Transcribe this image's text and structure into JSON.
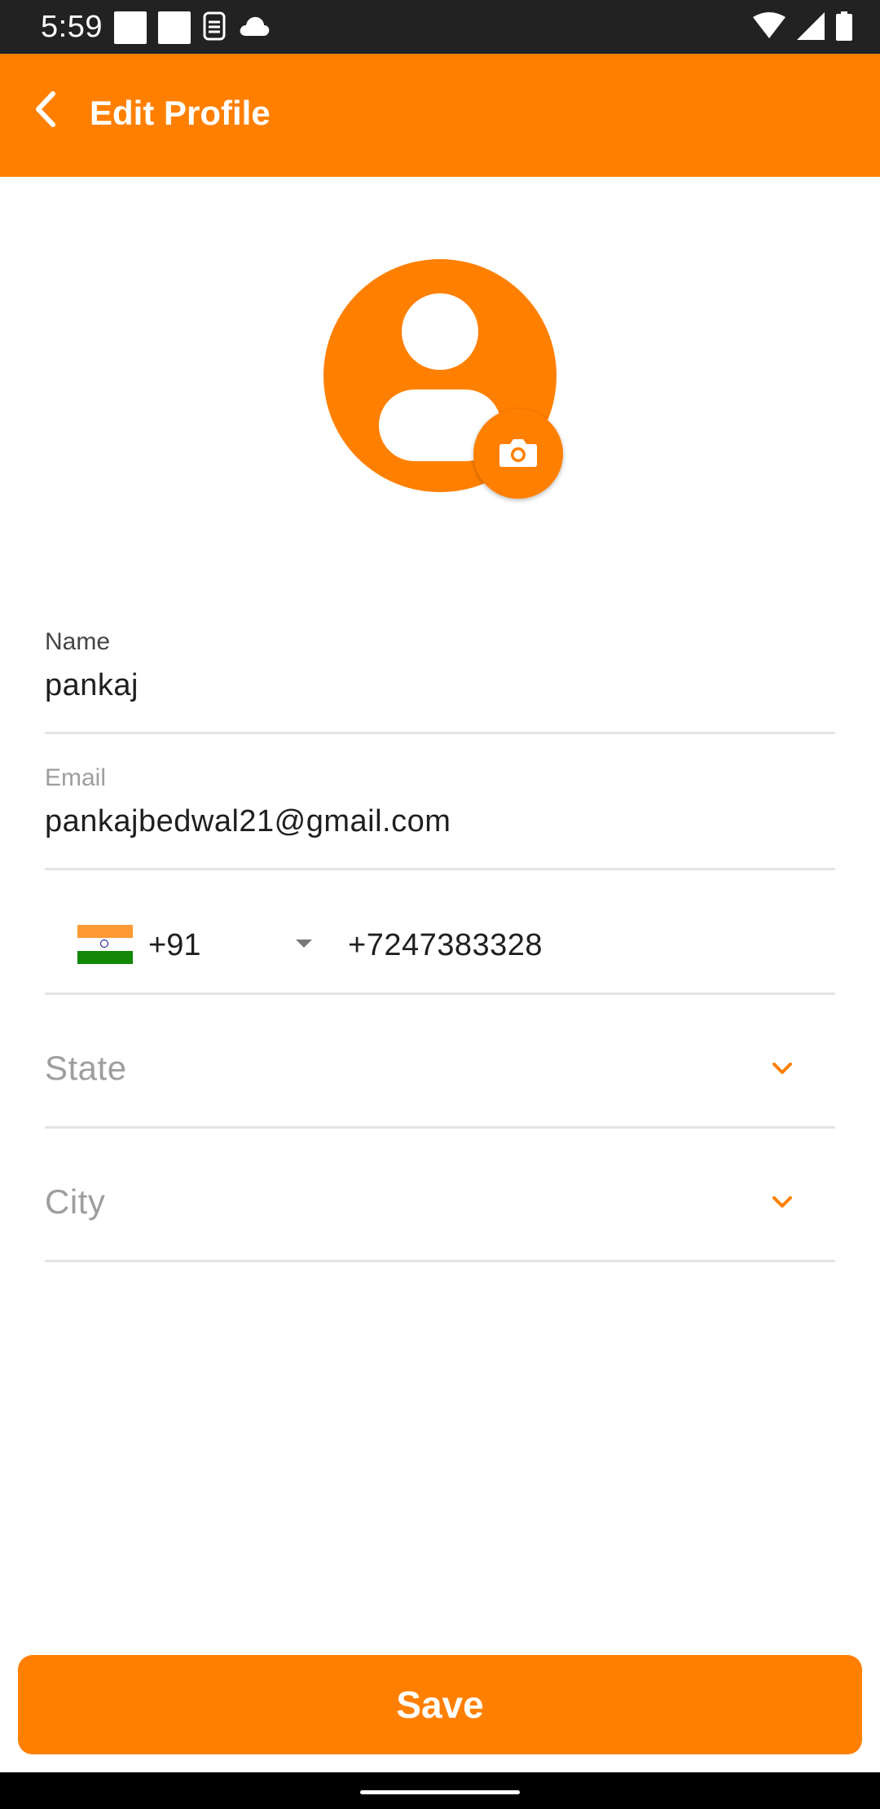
{
  "status_bar": {
    "time": "5:59",
    "left_icons": [
      "square-notification-icon",
      "square-notification-icon",
      "sim-card-icon",
      "cloud-icon"
    ],
    "right_icons": [
      "wifi-icon",
      "cellular-signal-icon",
      "battery-icon"
    ]
  },
  "app_bar": {
    "title": "Edit Profile",
    "back_icon": "chevron-left-icon",
    "background_color": "#ff8000"
  },
  "profile": {
    "avatar_icon": "person-icon",
    "camera_icon": "camera-icon"
  },
  "form": {
    "name": {
      "label": "Name",
      "value": "pankaj"
    },
    "email": {
      "label": "Email",
      "value": "pankajbedwal21@gmail.com"
    },
    "phone": {
      "country_flag": "india-flag-icon",
      "dial_code": "+91",
      "number": "+7247383328"
    },
    "state": {
      "placeholder": "State"
    },
    "city": {
      "placeholder": "City"
    }
  },
  "actions": {
    "save_label": "Save"
  },
  "colors": {
    "accent": "#ff8000",
    "divider": "#e4e4e4",
    "placeholder": "#9e9e9e"
  }
}
